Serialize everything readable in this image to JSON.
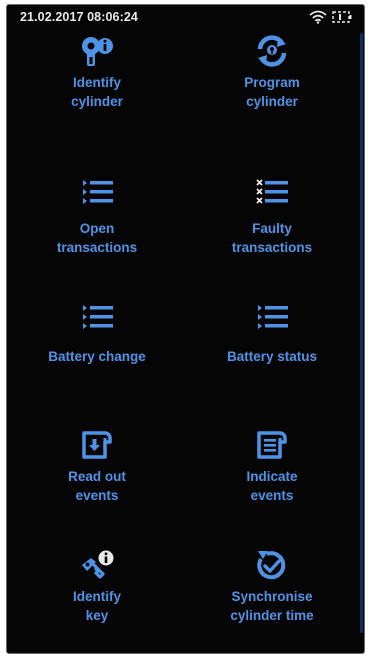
{
  "status_bar": {
    "datetime": "21.02.2017 08:06:24",
    "icons": [
      "wifi-icon",
      "battery-icon"
    ]
  },
  "menu": {
    "items": [
      {
        "label": "Identify\ncylinder",
        "icon": "cylinder-info-icon"
      },
      {
        "label": "Program\ncylinder",
        "icon": "cylinder-sync-icon"
      },
      {
        "label": "Open\ntransactions",
        "icon": "list-icon"
      },
      {
        "label": "Faulty\ntransactions",
        "icon": "faulty-list-icon"
      },
      {
        "label": "Battery change",
        "icon": "list-icon"
      },
      {
        "label": "Battery status",
        "icon": "list-icon"
      },
      {
        "label": "Read out\nevents",
        "icon": "read-events-icon"
      },
      {
        "label": "Indicate\nevents",
        "icon": "indicate-events-icon"
      },
      {
        "label": "Identify\nkey",
        "icon": "key-info-icon"
      },
      {
        "label": "Synchronise\ncylinder time",
        "icon": "clock-sync-icon"
      }
    ]
  },
  "colors": {
    "accent": "#4f93e6",
    "background": "#050505",
    "statusbar_text": "#e8e8e8"
  }
}
